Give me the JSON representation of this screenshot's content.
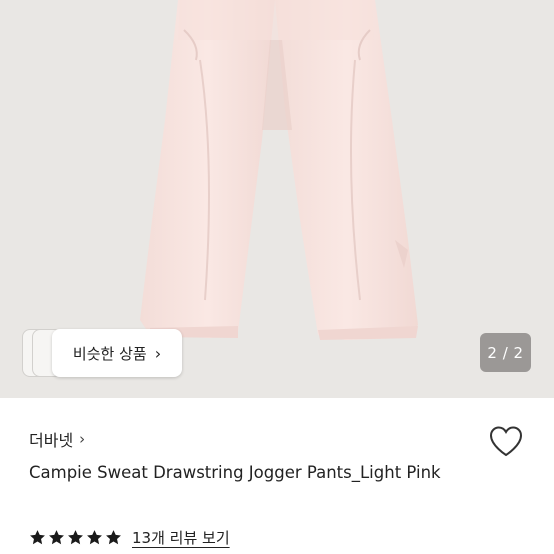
{
  "gallery": {
    "similar_button_label": "비슷한 상품",
    "chevron_right": "›",
    "page_counter": "2 / 2",
    "current_page": 2,
    "total_pages": 2
  },
  "product": {
    "brand": "더바넷",
    "brand_chevron": "›",
    "title": "Campie Sweat Drawstring Jogger Pants_Light Pink",
    "rating_stars": 5,
    "review_link": "13개 리뷰 보기"
  },
  "colors": {
    "image_background": "#e9e7e4",
    "pants": "#f8e3df",
    "counter_background": "#9b9896",
    "star": "#1a1a1a"
  }
}
